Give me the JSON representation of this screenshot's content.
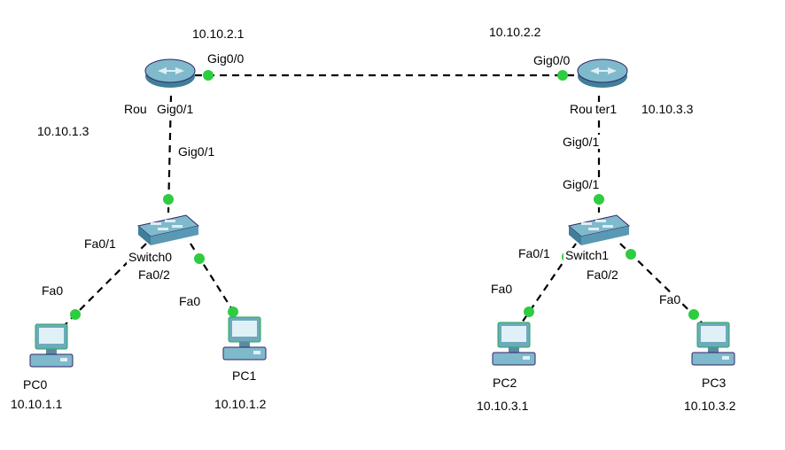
{
  "diagram": {
    "ips": {
      "router0_g00": "10.10.2.1",
      "router1_g00": "10.10.2.2",
      "router0_lan_extra": "10.10.1.3",
      "router1_lan_extra": "10.10.3.3",
      "pc0": "10.10.1.1",
      "pc1": "10.10.1.2",
      "pc2": "10.10.3.1",
      "pc3": "10.10.3.2"
    },
    "ports": {
      "gig00": "Gig0/0",
      "gig01": "Gig0/1",
      "fa01": "Fa0/1",
      "fa02": "Fa0/2",
      "fa0": "Fa0"
    },
    "names": {
      "router0": "Router0",
      "router1": "Router1",
      "switch0": "Switch0",
      "switch1": "Switch1",
      "pc0": "PC0",
      "pc1": "PC1",
      "pc2": "PC2",
      "pc3": "PC3"
    }
  },
  "chart_data": {
    "type": "network-topology",
    "nodes": [
      {
        "id": "Router0",
        "type": "router",
        "interfaces": {
          "Gig0/0": "10.10.2.1",
          "Gig0/1": "10.10.1.3"
        }
      },
      {
        "id": "Router1",
        "type": "router",
        "interfaces": {
          "Gig0/0": "10.10.2.2",
          "Gig0/1": "10.10.3.3"
        }
      },
      {
        "id": "Switch0",
        "type": "switch"
      },
      {
        "id": "Switch1",
        "type": "switch"
      },
      {
        "id": "PC0",
        "type": "pc",
        "ip": "10.10.1.1",
        "interface": "Fa0"
      },
      {
        "id": "PC1",
        "type": "pc",
        "ip": "10.10.1.2",
        "interface": "Fa0"
      },
      {
        "id": "PC2",
        "type": "pc",
        "ip": "10.10.3.1",
        "interface": "Fa0"
      },
      {
        "id": "PC3",
        "type": "pc",
        "ip": "10.10.3.2",
        "interface": "Fa0"
      }
    ],
    "links": [
      {
        "from": "Router0",
        "from_port": "Gig0/0",
        "to": "Router1",
        "to_port": "Gig0/0"
      },
      {
        "from": "Router0",
        "from_port": "Gig0/1",
        "to": "Switch0",
        "to_port": "Gig0/1"
      },
      {
        "from": "Router1",
        "from_port": "Gig0/1",
        "to": "Switch1",
        "to_port": "Gig0/1"
      },
      {
        "from": "Switch0",
        "from_port": "Fa0/1",
        "to": "PC0",
        "to_port": "Fa0"
      },
      {
        "from": "Switch0",
        "from_port": "Fa0/2",
        "to": "PC1",
        "to_port": "Fa0"
      },
      {
        "from": "Switch1",
        "from_port": "Fa0/1",
        "to": "PC2",
        "to_port": "Fa0"
      },
      {
        "from": "Switch1",
        "from_port": "Fa0/2",
        "to": "PC3",
        "to_port": "Fa0"
      }
    ]
  }
}
